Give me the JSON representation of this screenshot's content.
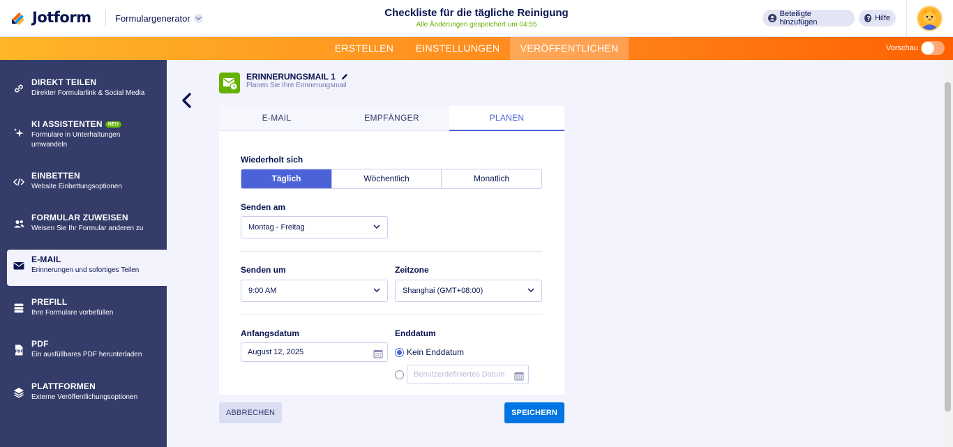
{
  "header": {
    "logo_text": "Jotform",
    "builder_label": "Formulargenerator",
    "form_title": "Checkliste für die tägliche Reinigung",
    "saved_status": "Alle Änderungen gespeichert um 04:55",
    "invite_label": "Beteiligte hinzufügen",
    "help_label": "Hilfe"
  },
  "nav": {
    "tabs": [
      "ERSTELLEN",
      "EINSTELLUNGEN",
      "VERÖFFENTLICHEN"
    ],
    "active": "VERÖFFENTLICHEN",
    "preview_label": "Vorschau"
  },
  "sidebar": {
    "items": [
      {
        "title": "DIREKT TEILEN",
        "desc": "Direkter Formularlink & Social Media",
        "icon": "link-icon"
      },
      {
        "title": "KI ASSISTENTEN",
        "badge": "NEU",
        "desc": "Formulare in Unterhaltungen umwandeln",
        "icon": "sparkle-icon"
      },
      {
        "title": "EINBETTEN",
        "desc": "Website Einbettungsoptionen",
        "icon": "code-icon"
      },
      {
        "title": "FORMULAR ZUWEISEN",
        "desc": "Weisen Sie Ihr Formular anderen zu",
        "icon": "users-icon"
      },
      {
        "title": "E-MAIL",
        "desc": "Erinnerungen und sofortiges Teilen",
        "icon": "envelope-icon",
        "active": true
      },
      {
        "title": "PREFILL",
        "desc": "Ihre Formulare vorbefüllen",
        "icon": "prefill-icon"
      },
      {
        "title": "PDF",
        "desc": "Ein ausfüllbares PDF herunterladen",
        "icon": "pdf-icon"
      },
      {
        "title": "PLATTFORMEN",
        "desc": "Externe Veröffentlichungsoptionen",
        "icon": "layers-icon"
      }
    ]
  },
  "reminder": {
    "title": "ERINNERUNGSMAIL 1",
    "subtitle": "Planen Sie Ihre Erinnerungsmail"
  },
  "tabs": [
    "E-MAIL",
    "EMPFÄNGER",
    "PLANEN"
  ],
  "schedule": {
    "repeat_label": "Wiederholt sich",
    "repeat_options": [
      "Täglich",
      "Wöchentlich",
      "Monatlich"
    ],
    "repeat_selected": "Täglich",
    "send_on_label": "Senden am",
    "send_on_value": "Montag - Freitag",
    "send_at_label": "Senden um",
    "send_at_value": "9:00 AM",
    "timezone_label": "Zeitzone",
    "timezone_value": "Shanghai (GMT+08:00)",
    "start_label": "Anfangsdatum",
    "start_value": "August 12, 2025",
    "end_label": "Enddatum",
    "end_option_none": "Kein Enddatum",
    "end_custom_placeholder": "Benutzerdefiniertes Datum"
  },
  "actions": {
    "cancel": "ABBRECHEN",
    "save": "SPEICHERN"
  },
  "colors": {
    "accent": "#4c63d8",
    "sidebar": "#343c6a",
    "save": "#0075e3",
    "green": "#64b200"
  }
}
